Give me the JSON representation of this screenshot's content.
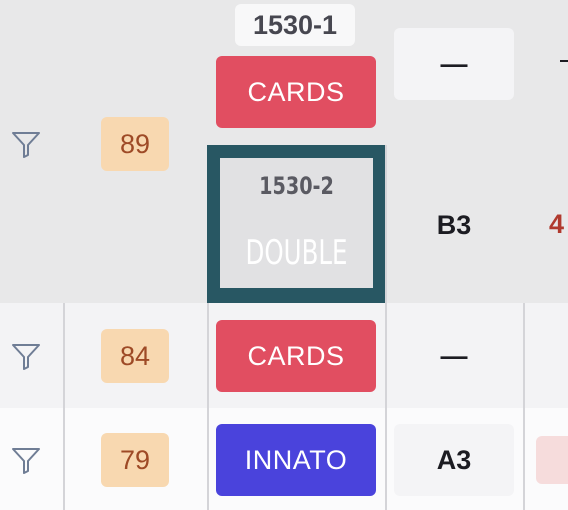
{
  "colors": {
    "cards": "#e14e61",
    "innato": "#4a43dc",
    "selected_border": "#285763",
    "badge_bg": "#f8d8b0",
    "badge_text": "#9e4a26"
  },
  "rows": [
    {
      "icon": "filter-icon",
      "score": "89",
      "id": "1530-1",
      "tag": "CARDS",
      "slot": "—"
    },
    {
      "id": "1530-2",
      "tag": "DOUBLE",
      "slot": "B3",
      "edge": "4"
    },
    {
      "icon": "filter-icon",
      "score": "84",
      "tag": "CARDS",
      "slot": "—"
    },
    {
      "icon": "filter-icon",
      "score": "79",
      "tag": "INNATO",
      "slot": "A3"
    }
  ]
}
